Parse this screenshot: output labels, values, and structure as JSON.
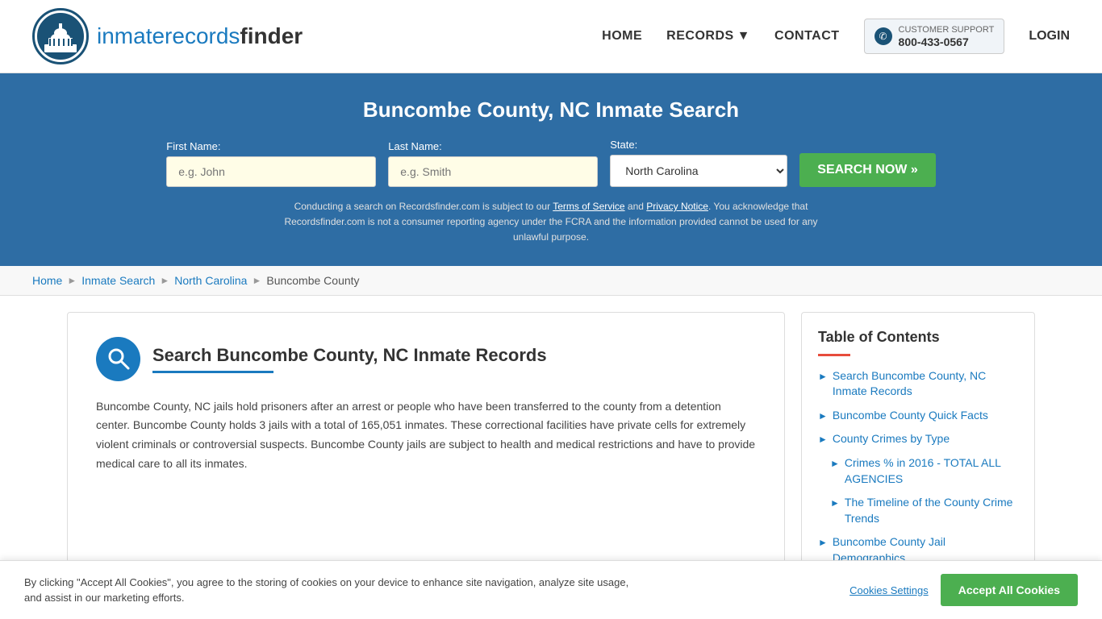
{
  "header": {
    "logo_text_part1": "inmaterecords",
    "logo_text_part2": "finder",
    "nav": {
      "home": "HOME",
      "records": "RECORDS",
      "contact": "CONTACT",
      "support_label": "CUSTOMER SUPPORT",
      "support_number": "800-433-0567",
      "login": "LOGIN"
    }
  },
  "hero": {
    "title": "Buncombe County, NC Inmate Search",
    "form": {
      "first_name_label": "First Name:",
      "first_name_placeholder": "e.g. John",
      "last_name_label": "Last Name:",
      "last_name_placeholder": "e.g. Smith",
      "state_label": "State:",
      "state_value": "North Carolina",
      "search_button": "SEARCH NOW »"
    },
    "disclaimer": "Conducting a search on Recordsfinder.com is subject to our Terms of Service and Privacy Notice. You acknowledge that Recordsfinder.com is not a consumer reporting agency under the FCRA and the information provided cannot be used for any unlawful purpose."
  },
  "breadcrumb": {
    "home": "Home",
    "inmate_search": "Inmate Search",
    "state": "North Carolina",
    "county": "Buncombe County"
  },
  "article": {
    "title": "Search Buncombe County, NC Inmate Records",
    "body": "Buncombe County, NC jails hold prisoners after an arrest or people who have been transferred to the county from a detention center. Buncombe County holds 3 jails with a total of 165,051 inmates. These correctional facilities have private cells for extremely violent criminals or controversial suspects. Buncombe County jails are subject to health and medical restrictions and have to provide medical care to all its inmates."
  },
  "toc": {
    "title": "Table of Contents",
    "items": [
      {
        "label": "Search Buncombe County, NC Inmate Records",
        "sub": false
      },
      {
        "label": "Buncombe County Quick Facts",
        "sub": false
      },
      {
        "label": "County Crimes by Type",
        "sub": false
      },
      {
        "label": "Crimes % in 2016 - TOTAL ALL AGENCIES",
        "sub": true
      },
      {
        "label": "The Timeline of the County Crime Trends",
        "sub": true
      },
      {
        "label": "Buncombe County Jail Demographics",
        "sub": false
      }
    ]
  },
  "cookie": {
    "text": "By clicking \"Accept All Cookies\", you agree to the storing of cookies on your device to enhance site navigation, analyze site usage, and assist in our marketing efforts.",
    "settings_label": "Cookies Settings",
    "accept_label": "Accept All Cookies"
  }
}
